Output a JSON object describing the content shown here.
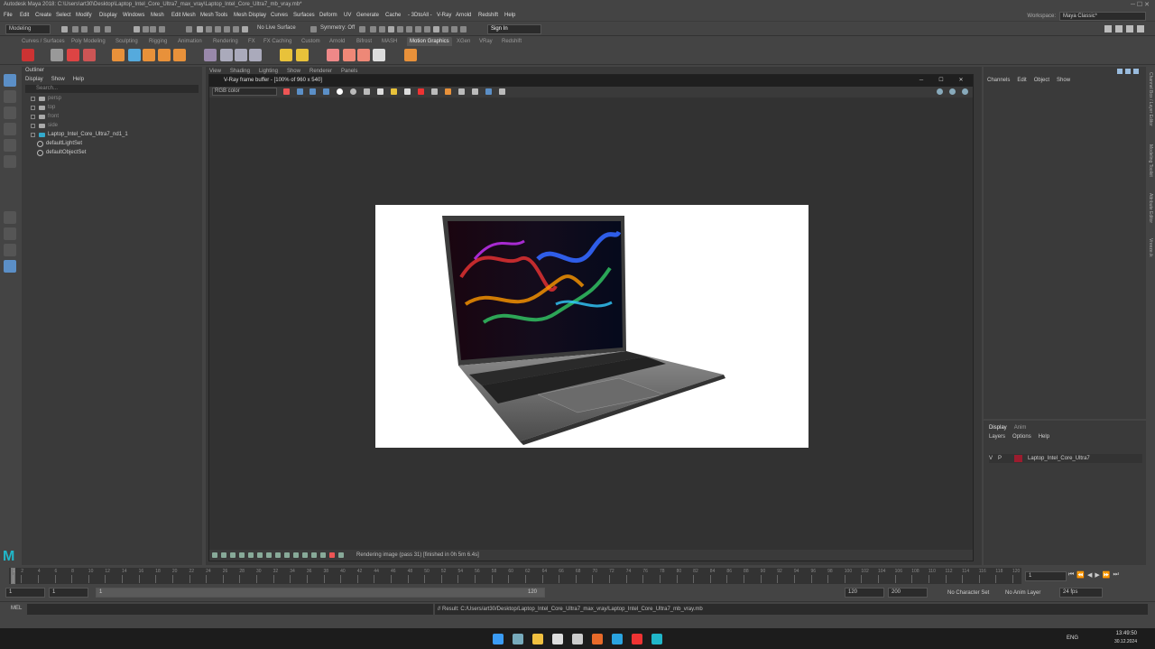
{
  "app": {
    "title": "Autodesk Maya 2018: C:\\Users\\art30\\Desktop\\Laptop_Intel_Core_Ultra7_max_vray\\Laptop_Intel_Core_Ultra7_mb_vray.mb*"
  },
  "menu": [
    "File",
    "Edit",
    "Create",
    "Select",
    "Modify",
    "Display",
    "Windows",
    "Mesh",
    "Edit Mesh",
    "Mesh Tools",
    "Mesh Display",
    "Curves",
    "Surfaces",
    "Deform",
    "UV",
    "Generate",
    "Cache",
    "- 3DtoAll -",
    "V-Ray",
    "Arnold",
    "Redshift",
    "Help"
  ],
  "workspace": {
    "label": "Workspace:",
    "value": "Maya Classic*"
  },
  "status": {
    "mode": "Modeling",
    "live_surface": "No Live Surface",
    "symmetry": "Symmetry: Off",
    "sign_in": "Sign In"
  },
  "shelf_tabs": [
    "Curves / Surfaces",
    "Poly Modeling",
    "Sculpting",
    "Rigging",
    "Animation",
    "Rendering",
    "FX",
    "FX Caching",
    "Custom",
    "Arnold",
    "Bifrost",
    "MASH",
    "Motion Graphics",
    "XGen",
    "VRay",
    "Redshift"
  ],
  "shelf_active": "Motion Graphics",
  "outliner": {
    "title": "Outliner",
    "menu": [
      "Display",
      "Show",
      "Help"
    ],
    "search_placeholder": "Search...",
    "items": [
      {
        "label": "persp",
        "dim": true,
        "type": "camera"
      },
      {
        "label": "top",
        "dim": true,
        "type": "camera"
      },
      {
        "label": "front",
        "dim": true,
        "type": "camera"
      },
      {
        "label": "side",
        "dim": true,
        "type": "camera"
      },
      {
        "label": "Laptop_Intel_Core_Ultra7_nd1_1",
        "dim": false,
        "type": "group"
      },
      {
        "label": "defaultLightSet",
        "dim": false,
        "type": "set"
      },
      {
        "label": "defaultObjectSet",
        "dim": false,
        "type": "set"
      }
    ]
  },
  "viewport_menu": [
    "View",
    "Shading",
    "Lighting",
    "Show",
    "Renderer",
    "Panels"
  ],
  "vray": {
    "title": "V-Ray frame buffer - [100% of 960 x 540]",
    "channel": "RGB color",
    "status": "Rendering image (pass 31) [finished in 0h 5m 6.4s]"
  },
  "channel_box": {
    "menu": [
      "Channels",
      "Edit",
      "Object",
      "Show"
    ]
  },
  "layers": {
    "tabs": [
      "Display",
      "Anim"
    ],
    "menu": [
      "Layers",
      "Options",
      "Help"
    ],
    "row": {
      "v": "V",
      "p": "P",
      "name": "Laptop_Intel_Core_Ultra7",
      "color": "#9b1c2e"
    }
  },
  "side_tabs": [
    "Channel Box / Layer Editor",
    "Modeling Toolkit",
    "Attribute Editor",
    "Vreeze.ik"
  ],
  "timeline": {
    "ticks": [
      "1",
      "2",
      "4",
      "6",
      "8",
      "10",
      "12",
      "14",
      "16",
      "18",
      "20",
      "22",
      "24",
      "26",
      "28",
      "30",
      "32",
      "34",
      "36",
      "38",
      "40",
      "42",
      "44",
      "46",
      "48",
      "50",
      "52",
      "54",
      "56",
      "58",
      "60",
      "62",
      "64",
      "66",
      "68",
      "70",
      "72",
      "74",
      "76",
      "78",
      "80",
      "82",
      "84",
      "86",
      "88",
      "90",
      "92",
      "94",
      "96",
      "98",
      "100",
      "102",
      "104",
      "106",
      "108",
      "110",
      "112",
      "114",
      "116",
      "118",
      "120"
    ],
    "current": "1"
  },
  "range": {
    "start": "1",
    "start2": "1",
    "range_start": "1",
    "range_end": "120",
    "end": "120",
    "end2": "200",
    "character_set": "No Character Set",
    "anim_layer": "No Anim Layer",
    "fps": "24 fps"
  },
  "cmd": {
    "label": "MEL",
    "result": "// Result: C:/Users/art30/Desktop/Laptop_Intel_Core_Ultra7_max_vray/Laptop_Intel_Core_Ultra7_mb_vray.mb"
  },
  "taskbar": {
    "lang": "ENG",
    "time": "13:49:50",
    "date": "30.12.2024"
  }
}
